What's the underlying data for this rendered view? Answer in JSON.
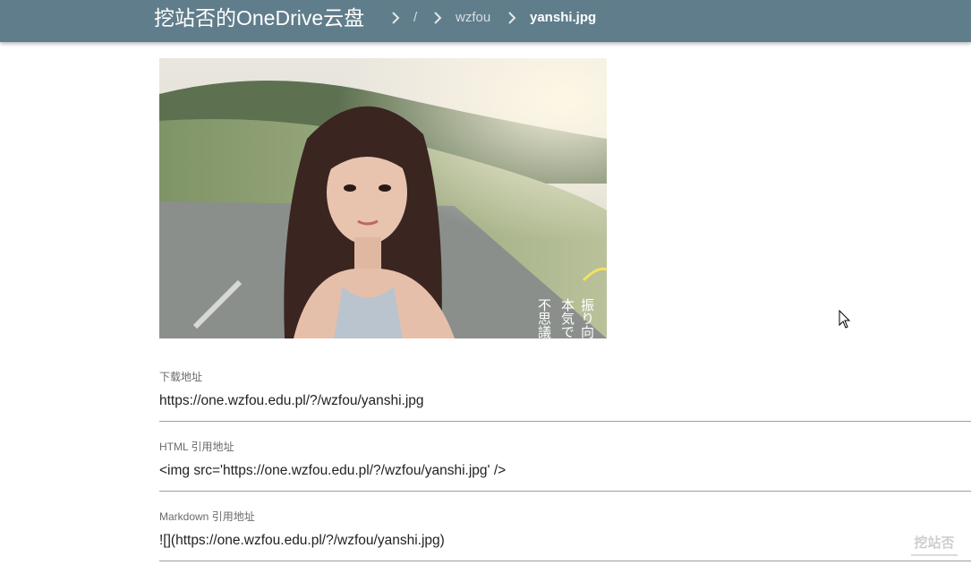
{
  "header": {
    "title": "挖站否的OneDrive云盘",
    "breadcrumbs": [
      "/",
      "wzfou",
      "yanshi.jpg"
    ]
  },
  "preview": {
    "file": "yanshi.jpg",
    "overlay_text": [
      "振り向く",
      "本気でそ",
      "不思議な"
    ]
  },
  "fields": [
    {
      "label": "下载地址",
      "value": "https://one.wzfou.edu.pl/?/wzfou/yanshi.jpg"
    },
    {
      "label": "HTML 引用地址",
      "value": "<img src='https://one.wzfou.edu.pl/?/wzfou/yanshi.jpg' />"
    },
    {
      "label": "Markdown 引用地址",
      "value": "![](https://one.wzfou.edu.pl/?/wzfou/yanshi.jpg)"
    }
  ],
  "watermark": "挖站否",
  "colors": {
    "topbar": "#607d8b",
    "topbar_text": "#ffffff",
    "crumb_text": "#d7dfe3"
  }
}
